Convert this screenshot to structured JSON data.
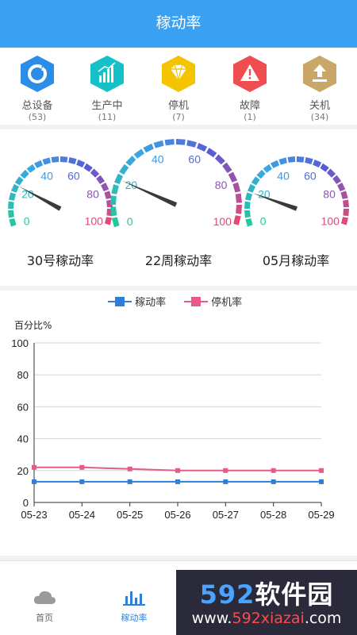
{
  "header": {
    "title": "稼动率"
  },
  "stats": [
    {
      "label": "总设备",
      "count": "(53)",
      "icon": "refresh-icon",
      "color": "#2b8de6"
    },
    {
      "label": "生产中",
      "count": "(11)",
      "icon": "bar-chart-icon",
      "color": "#15c0c8"
    },
    {
      "label": "停机",
      "count": "(7)",
      "icon": "diamond-icon",
      "color": "#f5c400"
    },
    {
      "label": "故障",
      "count": "(1)",
      "icon": "warning-icon",
      "color": "#ef4e50"
    },
    {
      "label": "关机",
      "count": "(34)",
      "icon": "upload-icon",
      "color": "#c9a867"
    }
  ],
  "gauges": [
    {
      "caption": "30号稼动率",
      "value": 22,
      "ticks": [
        "0",
        "20",
        "40",
        "60",
        "80",
        "100"
      ]
    },
    {
      "caption": "22周稼动率",
      "value": 20,
      "ticks": [
        "0",
        "20",
        "40",
        "60",
        "80",
        "100"
      ]
    },
    {
      "caption": "05月稼动率",
      "value": 18,
      "ticks": [
        "0",
        "20",
        "40",
        "60",
        "80",
        "100"
      ]
    }
  ],
  "chart_data": {
    "type": "line",
    "ylabel": "百分比%",
    "ylim": [
      0,
      100
    ],
    "yticks": [
      "0",
      "20",
      "40",
      "60",
      "80",
      "100"
    ],
    "x": [
      "05-23",
      "05-24",
      "05-25",
      "05-26",
      "05-27",
      "05-28",
      "05-29"
    ],
    "series": [
      {
        "name": "稼动率",
        "color": "#2f7fd8",
        "values": [
          13,
          13,
          13,
          13,
          13,
          13,
          13
        ]
      },
      {
        "name": "停机率",
        "color": "#e75b8a",
        "values": [
          22,
          22,
          21,
          20,
          20,
          20,
          20
        ]
      }
    ],
    "grid": true,
    "legend": "top-center"
  },
  "tabbar": [
    {
      "label": "首页",
      "icon": "cloud-icon",
      "active": false
    },
    {
      "label": "稼动率",
      "icon": "bar-chart-icon",
      "active": true
    }
  ],
  "watermark": {
    "brand_num": "592",
    "brand_text": "软件园",
    "url_pre": "www.",
    "url_mid": "592xiazai",
    "url_post": ".com"
  }
}
